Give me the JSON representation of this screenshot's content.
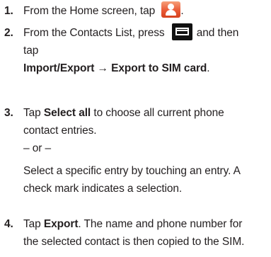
{
  "steps": [
    {
      "number": "1.",
      "text_before": "From the Home screen, tap",
      "icon": "contacts-icon",
      "text_after": "."
    },
    {
      "number": "2.",
      "text_before": "From the Contacts List, press",
      "icon": "menu-icon",
      "text_after": "and then",
      "line2": "tap",
      "bold_line": "Import/Export → Export to SIM card",
      "bold_line_end": "."
    },
    {
      "number": "3.",
      "prefix": "Tap",
      "bold": "Select all",
      "line1_rest": "to choose all current phone",
      "line2": "contact entries.",
      "or_text": "– or –",
      "alt_line1": "Select a specific entry by touching an entry. A",
      "alt_line2": "check mark indicates a selection."
    },
    {
      "number": "4.",
      "prefix": "Tap",
      "bold": "Export",
      "line1_rest": ". The name and phone number for",
      "line2": "the selected contact is then copied to the SIM."
    }
  ],
  "icons": {
    "contacts_color": "#ea5a36",
    "menu_color": "#111111"
  }
}
